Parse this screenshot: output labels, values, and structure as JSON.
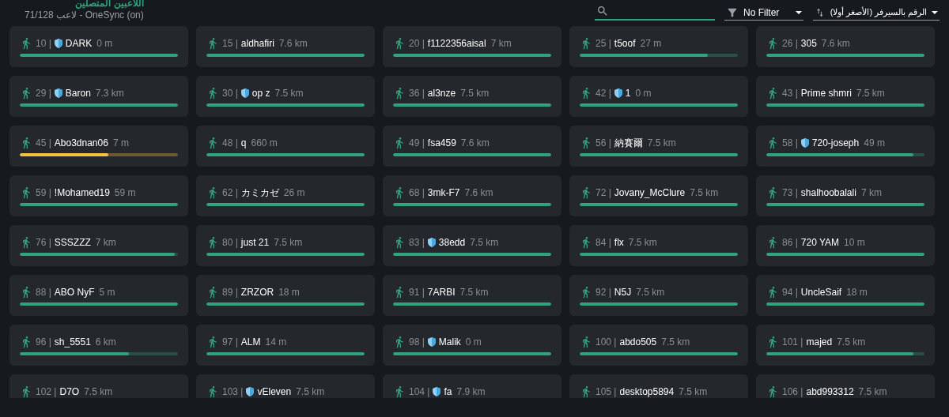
{
  "header": {
    "title": "اللاعبين المتصلين",
    "subtitle": "71/128 لاعب - OneSync (on)"
  },
  "filter": {
    "value": "No Filter"
  },
  "sort": {
    "value": "الرقم بالسيرفر (الأصغر أولا)"
  },
  "players": [
    {
      "id": "10 |",
      "name": "DARK",
      "distance": "0 m",
      "shield": true,
      "level": 1,
      "color": "#2fa37c"
    },
    {
      "id": "15 |",
      "name": "aldhafiri",
      "distance": "7.6 km",
      "shield": false,
      "level": 1,
      "color": "#2fa37c"
    },
    {
      "id": "20 |",
      "name": "f1122356aisal",
      "distance": "7 km",
      "shield": false,
      "level": 1,
      "color": "#2fa37c"
    },
    {
      "id": "25 |",
      "name": "t5oof",
      "distance": "27 m",
      "shield": false,
      "level": 0.81,
      "color": "#2fa37c"
    },
    {
      "id": "26 |",
      "name": "305",
      "distance": "7.6 km",
      "shield": false,
      "level": 1,
      "color": "#2fa37c"
    },
    {
      "id": "29 |",
      "name": "Baron",
      "distance": "7.3 km",
      "shield": true,
      "level": 1,
      "color": "#2fa37c"
    },
    {
      "id": "30 |",
      "name": "op z",
      "distance": "7.5 km",
      "shield": true,
      "level": 1,
      "color": "#2fa37c"
    },
    {
      "id": "36 |",
      "name": "al3nze",
      "distance": "7.5 km",
      "shield": false,
      "level": 1,
      "color": "#2fa37c"
    },
    {
      "id": "42 |",
      "name": "1",
      "distance": "0 m",
      "shield": true,
      "level": 1,
      "color": "#2fa37c"
    },
    {
      "id": "43 |",
      "name": "Prime shmri",
      "distance": "7.5 km",
      "shield": false,
      "level": 1,
      "color": "#2fa37c"
    },
    {
      "id": "45 |",
      "name": "Abo3dnan06",
      "distance": "7 m",
      "shield": false,
      "level": 0.56,
      "color": "#f5c242"
    },
    {
      "id": "48 |",
      "name": "q",
      "distance": "660 m",
      "shield": false,
      "level": 1,
      "color": "#2fa37c"
    },
    {
      "id": "49 |",
      "name": "fsa459",
      "distance": "7.6 km",
      "shield": false,
      "level": 1,
      "color": "#2fa37c"
    },
    {
      "id": "56 |",
      "name": "納賽爾",
      "distance": "7.5 km",
      "shield": false,
      "level": 1,
      "color": "#2fa37c"
    },
    {
      "id": "58 |",
      "name": "720-joseph",
      "distance": "49 m",
      "shield": true,
      "level": 0.93,
      "color": "#2fa37c"
    },
    {
      "id": "59 |",
      "name": "!Mohamed19",
      "distance": "59 m",
      "shield": false,
      "level": 1,
      "color": "#2fa37c"
    },
    {
      "id": "62 |",
      "name": "カミカゼ",
      "distance": "26 m",
      "shield": false,
      "level": 1,
      "color": "#2fa37c"
    },
    {
      "id": "68 |",
      "name": "3mk-F7",
      "distance": "7.6 km",
      "shield": false,
      "level": 1,
      "color": "#2fa37c"
    },
    {
      "id": "72 |",
      "name": "Jovany_McClure",
      "distance": "7.5 km",
      "shield": false,
      "level": 1,
      "color": "#2fa37c"
    },
    {
      "id": "73 |",
      "name": "shalhoobalali",
      "distance": "7 km",
      "shield": false,
      "level": 1,
      "color": "#2fa37c"
    },
    {
      "id": "76 |",
      "name": "SSSZZZ",
      "distance": "7 km",
      "shield": false,
      "level": 0.98,
      "color": "#2fa37c"
    },
    {
      "id": "80 |",
      "name": "just 21",
      "distance": "7.5 km",
      "shield": false,
      "level": 1,
      "color": "#2fa37c"
    },
    {
      "id": "83 |",
      "name": "38edd",
      "distance": "7.5 km",
      "shield": true,
      "level": 1,
      "color": "#2fa37c"
    },
    {
      "id": "84 |",
      "name": "flx",
      "distance": "7.5 km",
      "shield": false,
      "level": 1,
      "color": "#2fa37c"
    },
    {
      "id": "86 |",
      "name": "720 YAM",
      "distance": "10 m",
      "shield": false,
      "level": 1,
      "color": "#2fa37c"
    },
    {
      "id": "88 |",
      "name": "ABO NyF",
      "distance": "5 m",
      "shield": false,
      "level": 1,
      "color": "#2fa37c"
    },
    {
      "id": "89 |",
      "name": "ZRZOR",
      "distance": "18 m",
      "shield": false,
      "level": 1,
      "color": "#2fa37c"
    },
    {
      "id": "91 |",
      "name": "7ARBI",
      "distance": "7.5 km",
      "shield": false,
      "level": 1,
      "color": "#2fa37c"
    },
    {
      "id": "92 |",
      "name": "N5J",
      "distance": "7.5 km",
      "shield": false,
      "level": 1,
      "color": "#2fa37c"
    },
    {
      "id": "94 |",
      "name": "UncleSaif",
      "distance": "18 m",
      "shield": false,
      "level": 1,
      "color": "#2fa37c"
    },
    {
      "id": "96 |",
      "name": "sh_5551",
      "distance": "6 km",
      "shield": false,
      "level": 0.69,
      "color": "#2fa37c"
    },
    {
      "id": "97 |",
      "name": "ALM",
      "distance": "14 m",
      "shield": false,
      "level": 1,
      "color": "#2fa37c"
    },
    {
      "id": "98 |",
      "name": "Malik",
      "distance": "0 m",
      "shield": true,
      "level": 1,
      "color": "#2fa37c"
    },
    {
      "id": "100 |",
      "name": "abdo505",
      "distance": "7.5 km",
      "shield": false,
      "level": 1,
      "color": "#2fa37c"
    },
    {
      "id": "101 |",
      "name": "majed",
      "distance": "7.5 km",
      "shield": false,
      "level": 0.93,
      "color": "#2fa37c"
    },
    {
      "id": "102 |",
      "name": "D7O",
      "distance": "7.5 km",
      "shield": false
    },
    {
      "id": "103 |",
      "name": "vEleven",
      "distance": "7.5 km",
      "shield": true
    },
    {
      "id": "104 |",
      "name": "fa",
      "distance": "7.9 km",
      "shield": true
    },
    {
      "id": "105 |",
      "name": "desktop5894",
      "distance": "7.5 km",
      "shield": false
    },
    {
      "id": "106 |",
      "name": "abd993312",
      "distance": "7.5 km",
      "shield": false
    }
  ]
}
